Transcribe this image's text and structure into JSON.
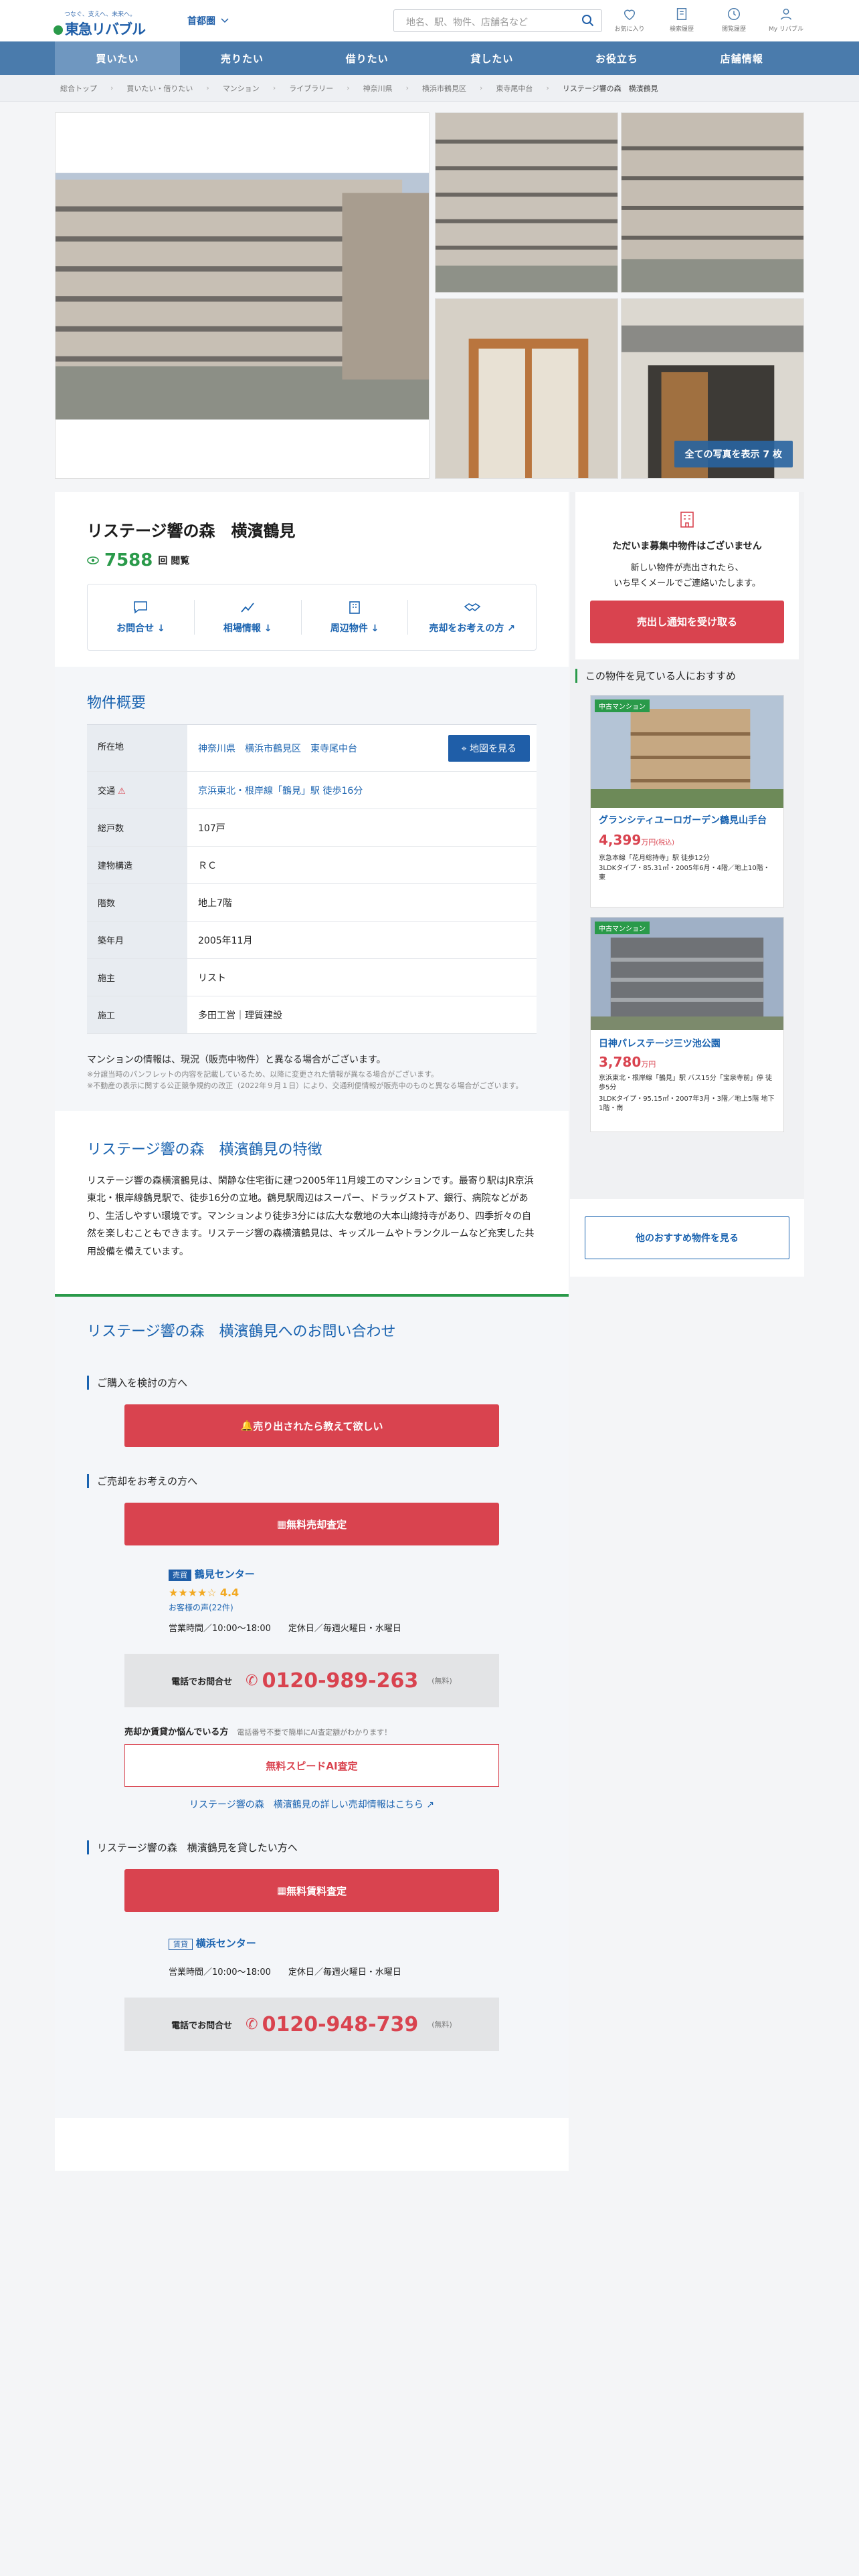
{
  "header": {
    "tagline": "つなぐ、支えへ、未来へ。",
    "logo": "東急リバブル",
    "area": "首都圏",
    "search_placeholder": "地名、駅、物件、店舗名など",
    "icons": [
      {
        "label": "お気に入り",
        "icon": "heart-icon"
      },
      {
        "label": "検索履歴",
        "icon": "book-icon"
      },
      {
        "label": "閲覧履歴",
        "icon": "clock-icon"
      },
      {
        "label": "My リバブル",
        "icon": "user-icon"
      }
    ]
  },
  "nav": [
    "買いたい",
    "売りたい",
    "借りたい",
    "貸したい",
    "お役立ち",
    "店舗情報"
  ],
  "breadcrumb": [
    "総合トップ",
    "買いたい・借りたい",
    "マンション",
    "ライブラリー",
    "神奈川県",
    "横浜市鶴見区",
    "東寺尾中台",
    "リステージ響の森　横濱鶴見"
  ],
  "gallery": {
    "all_photos": "全ての写真を表示 7 枚"
  },
  "property": {
    "title": "リステージ響の森　横濱鶴見",
    "views": "7588",
    "views_unit": "回 閲覧",
    "tabs": [
      "お問合せ",
      "相場情報",
      "周辺物件",
      "売却をお考えの方"
    ]
  },
  "overview": {
    "heading": "物件概要",
    "rows": [
      {
        "k": "所在地",
        "v": "神奈川県　横浜市鶴見区　東寺尾中台"
      },
      {
        "k": "交通",
        "v": "京浜東北・根岸線「鶴見」駅 徒歩16分"
      },
      {
        "k": "総戸数",
        "v": "107戸"
      },
      {
        "k": "建物構造",
        "v": "ＲＣ"
      },
      {
        "k": "階数",
        "v": "地上7階"
      },
      {
        "k": "築年月",
        "v": "2005年11月"
      },
      {
        "k": "施主",
        "v": "リスト"
      },
      {
        "k": "施工",
        "v": "多田工営｜理質建設"
      }
    ],
    "map_button": "地図を見る",
    "note": "マンションの情報は、現況（販売中物件）と異なる場合がございます。",
    "small1": "※分譲当時のパンフレットの内容を記載しているため、以降に変更された情報が異なる場合がございます。",
    "small2": "※不動産の表示に関する公正競争規約の改正（2022年９月１日）により、交通利便情報が販売中のものと異なる場合がございます。"
  },
  "features": {
    "heading": "リステージ響の森　横濱鶴見の特徴",
    "body": "リステージ響の森横濱鶴見は、閑静な住宅街に建つ2005年11月竣工のマンションです。最寄り駅はJR京浜東北・根岸線鶴見駅で、徒歩16分の立地。鶴見駅周辺はスーパー、ドラッグストア、銀行、病院などがあり、生活しやすい環境です。マンションより徒歩3分には広大な敷地の大本山總持寺があり、四季折々の自然を楽しむこともできます。リステージ響の森横濱鶴見は、キッズルームやトランクルームなど充実した共用設備を備えています。"
  },
  "contact": {
    "heading": "リステージ響の森　横濱鶴見へのお問い合わせ",
    "buy_label": "ご購入を検討の方へ",
    "buy_button": "売り出されたら教えて欲しい",
    "sell_label": "ご売却をお考えの方へ",
    "sell_button": "無料売却査定",
    "center_badge": "売買",
    "center_name": "鶴見センター",
    "rating": "4.4",
    "reviews": "お客様の声(22件)",
    "hours": "営業時間／10:00〜18:00　　定休日／毎週火曜日・水曜日",
    "phone_label": "電話でお問合せ",
    "phone": "0120-989-263",
    "free": "(無料)",
    "ai_q": "売却か賃貸か悩んでいる方",
    "ai_hint": "電話番号不要で簡単にAI査定額がわかります！",
    "ai_button": "無料スピードAI査定",
    "detail_link": "リステージ響の森　横濱鶴見の詳しい売却情報はこちら",
    "rent_label": "リステージ響の森　横濱鶴見を貸したい方へ",
    "rent_button": "無料賃料査定",
    "rent_badge": "賃貸",
    "rent_center": "横浜センター",
    "rent_hours": "営業時間／10:00〜18:00　　定休日／毎週火曜日・水曜日",
    "rent_phone": "0120-948-739"
  },
  "side": {
    "no_listing": "ただいま募集中物件はございません",
    "desc1": "新しい物件が売出されたら、",
    "desc2": "いち早くメールでご連絡いたします。",
    "notify_button": "売出し通知を受け取る",
    "rec_heading": "この物件を見ている人におすすめ",
    "cards": [
      {
        "badge": "中古マンション",
        "name": "グランシティユーロガーデン鶴見山手台",
        "price": "4,399",
        "unit": "万円",
        "tax": "(税込)",
        "line1": "京急本線「花月総持寺」駅 徒歩12分",
        "line2": "3LDKタイプ・85.31㎡・2005年6月・4階／地上10階・東"
      },
      {
        "badge": "中古マンション",
        "name": "日神パレステージ三ツ池公園",
        "price": "3,780",
        "unit": "万円",
        "tax": "",
        "line1": "京浜東北・根岸線「鶴見」駅 バス15分「宝泉寺前」停 徒歩5分",
        "line2": "3LDKタイプ・95.15㎡・2007年3月・3階／地上5階 地下1階・南"
      }
    ],
    "more_button": "他のおすすめ物件を見る"
  },
  "colors": {
    "nav": "#4a7bac",
    "red": "#d9434f",
    "blue": "#1a63b0",
    "green": "#2a9a4a"
  }
}
